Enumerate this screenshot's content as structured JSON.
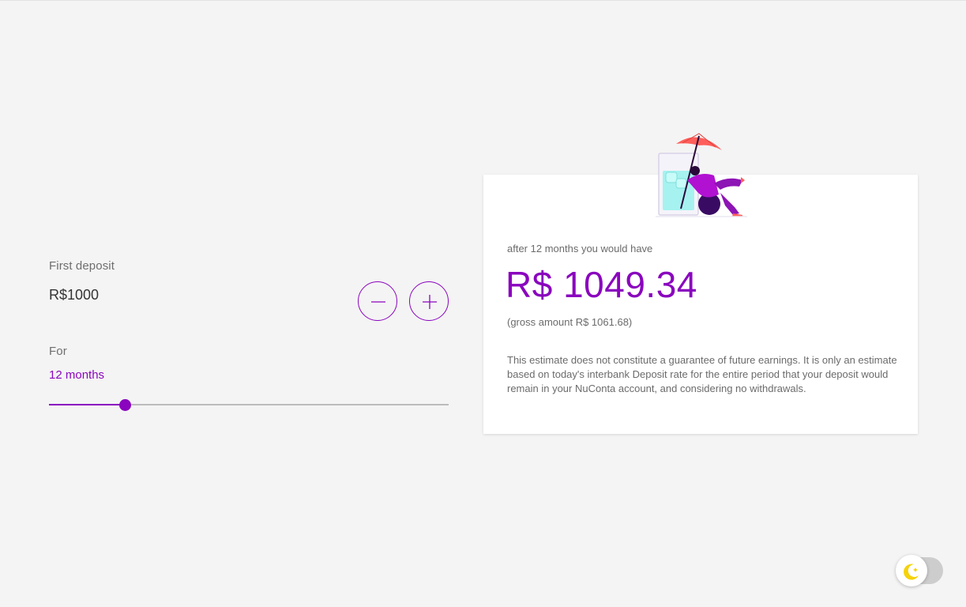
{
  "form": {
    "deposit_label": "First deposit",
    "deposit_value": "R$1000",
    "period_label": "For",
    "period_value": "12 months",
    "slider_level_percent": 19
  },
  "result": {
    "after_text": "after 12 months you would have",
    "amount": "R$ 1049.34",
    "gross": "(gross amount R$ 1061.68)",
    "disclaimer": "This estimate does not constitute a guarantee of future earnings. It is only an estimate based on today's interbank Deposit rate for the entire period that your deposit would remain in your NuConta account, and considering no withdrawals."
  },
  "icons": {
    "decrease": "minus-icon",
    "increase": "plus-icon",
    "theme": "moon-icon"
  },
  "colors": {
    "accent": "#8a05be",
    "background": "#f4f4f4",
    "toggle_moon": "#f5d20a"
  }
}
